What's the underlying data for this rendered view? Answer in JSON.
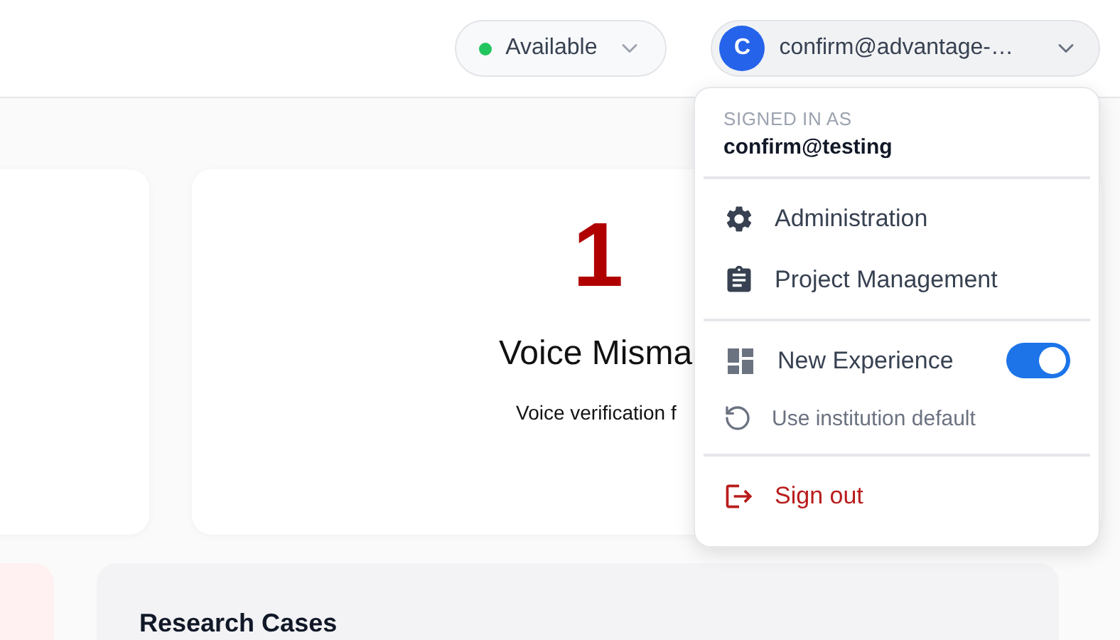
{
  "header": {
    "status": {
      "label": "Available",
      "color": "#22c55e"
    },
    "account": {
      "initial": "C",
      "email": "confirm@advantage-…"
    }
  },
  "cards": [
    {
      "kind": "blank"
    },
    {
      "kind": "stat",
      "value": "1",
      "title": "Voice Misma",
      "description": "Voice verification f"
    }
  ],
  "panels": [
    {
      "kind": "tinted"
    },
    {
      "kind": "section",
      "title": "Research Cases"
    }
  ],
  "menu": {
    "caption": "SIGNED IN AS",
    "user": "confirm@testing",
    "groups": [
      [
        {
          "kind": "link",
          "label": "Administration"
        },
        {
          "kind": "link",
          "label": "Project Management"
        }
      ],
      [
        {
          "kind": "toggle",
          "label": "New Experience",
          "on": true
        },
        {
          "kind": "subtle",
          "label": "Use institution default"
        }
      ],
      [
        {
          "kind": "danger",
          "label": "Sign out"
        }
      ]
    ]
  }
}
